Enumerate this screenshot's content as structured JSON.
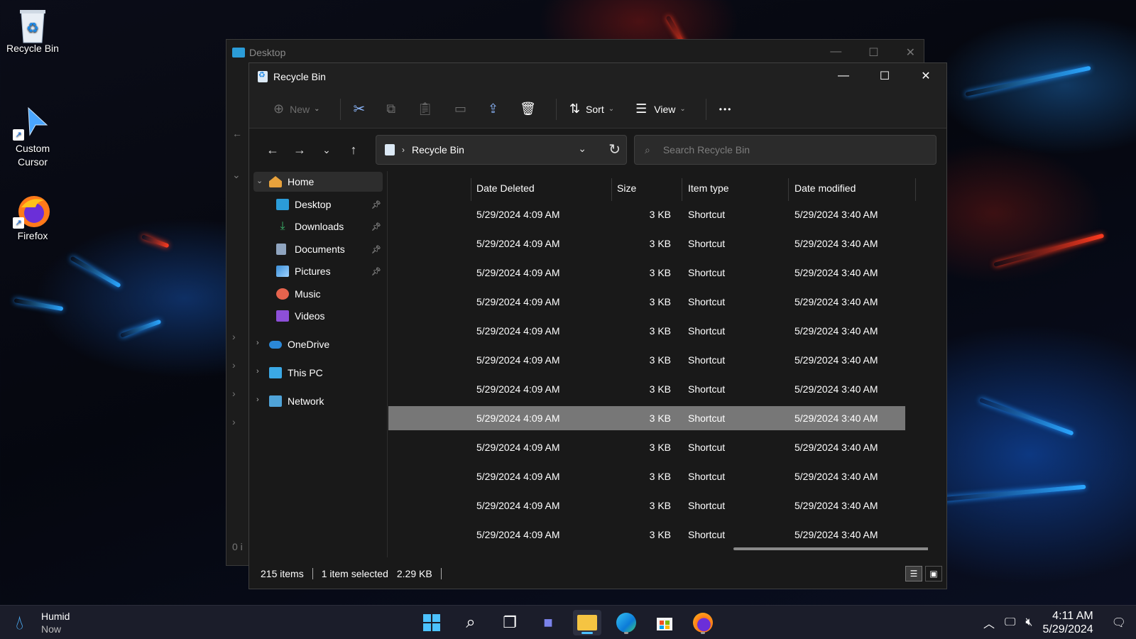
{
  "desktop": {
    "icons": [
      {
        "label": "Recycle Bin",
        "icon": "recycle-bin-icon"
      },
      {
        "label": "Custom Cursor",
        "icon": "cursor-shortcut-icon"
      },
      {
        "label": "Firefox",
        "icon": "firefox-icon"
      }
    ]
  },
  "back_window": {
    "title": "Desktop",
    "status": "0 i"
  },
  "window": {
    "title": "Recycle Bin",
    "controls": {
      "minimize": "—",
      "maximize": "☐",
      "close": "✕"
    }
  },
  "toolbar": {
    "new_label": "New",
    "sort_label": "Sort",
    "view_label": "View",
    "more_label": "•••",
    "icons": [
      "cut-icon",
      "copy-icon",
      "paste-icon",
      "rename-icon",
      "share-icon",
      "delete-icon"
    ]
  },
  "address": {
    "crumb": "Recycle Bin",
    "search_placeholder": "Search Recycle Bin"
  },
  "sidebar": {
    "home": "Home",
    "quick": [
      {
        "label": "Desktop",
        "pinned": true,
        "color": "#2b9cd8"
      },
      {
        "label": "Downloads",
        "pinned": true,
        "color": "#3bb36b"
      },
      {
        "label": "Documents",
        "pinned": true,
        "color": "#8fa4bf"
      },
      {
        "label": "Pictures",
        "pinned": true,
        "color": "#3b8fd8"
      },
      {
        "label": "Music",
        "pinned": false,
        "color": "#e5634d"
      },
      {
        "label": "Videos",
        "pinned": false,
        "color": "#8d4fd8"
      }
    ],
    "sections": [
      {
        "label": "OneDrive",
        "color": "#2b88d8"
      },
      {
        "label": "This PC",
        "color": "#3ba9e6"
      },
      {
        "label": "Network",
        "color": "#4fa3d8"
      }
    ]
  },
  "list": {
    "columns": [
      "Date Deleted",
      "Size",
      "Item type",
      "Date modified"
    ],
    "rows": [
      {
        "deleted": "5/29/2024 4:09 AM",
        "size": "3 KB",
        "type": "Shortcut",
        "modified": "5/29/2024 3:40 AM",
        "selected": false
      },
      {
        "deleted": "5/29/2024 4:09 AM",
        "size": "3 KB",
        "type": "Shortcut",
        "modified": "5/29/2024 3:40 AM",
        "selected": false
      },
      {
        "deleted": "5/29/2024 4:09 AM",
        "size": "3 KB",
        "type": "Shortcut",
        "modified": "5/29/2024 3:40 AM",
        "selected": false
      },
      {
        "deleted": "5/29/2024 4:09 AM",
        "size": "3 KB",
        "type": "Shortcut",
        "modified": "5/29/2024 3:40 AM",
        "selected": false
      },
      {
        "deleted": "5/29/2024 4:09 AM",
        "size": "3 KB",
        "type": "Shortcut",
        "modified": "5/29/2024 3:40 AM",
        "selected": false
      },
      {
        "deleted": "5/29/2024 4:09 AM",
        "size": "3 KB",
        "type": "Shortcut",
        "modified": "5/29/2024 3:40 AM",
        "selected": false
      },
      {
        "deleted": "5/29/2024 4:09 AM",
        "size": "3 KB",
        "type": "Shortcut",
        "modified": "5/29/2024 3:40 AM",
        "selected": false
      },
      {
        "deleted": "5/29/2024 4:09 AM",
        "size": "3 KB",
        "type": "Shortcut",
        "modified": "5/29/2024 3:40 AM",
        "selected": true
      },
      {
        "deleted": "5/29/2024 4:09 AM",
        "size": "3 KB",
        "type": "Shortcut",
        "modified": "5/29/2024 3:40 AM",
        "selected": false
      },
      {
        "deleted": "5/29/2024 4:09 AM",
        "size": "3 KB",
        "type": "Shortcut",
        "modified": "5/29/2024 3:40 AM",
        "selected": false
      },
      {
        "deleted": "5/29/2024 4:09 AM",
        "size": "3 KB",
        "type": "Shortcut",
        "modified": "5/29/2024 3:40 AM",
        "selected": false
      },
      {
        "deleted": "5/29/2024 4:09 AM",
        "size": "3 KB",
        "type": "Shortcut",
        "modified": "5/29/2024 3:40 AM",
        "selected": false
      }
    ]
  },
  "status": {
    "count": "215 items",
    "selected": "1 item selected",
    "size": "2.29 KB"
  },
  "taskbar": {
    "weather_title": "Humid",
    "weather_sub": "Now",
    "apps": [
      "start-icon",
      "search-icon",
      "task-view-icon",
      "chat-icon",
      "file-explorer-icon",
      "edge-icon",
      "store-icon",
      "firefox-icon"
    ],
    "time": "4:11 AM",
    "date": "5/29/2024"
  },
  "colors": {
    "accent": "#4cc2ff",
    "selection": "#777777",
    "window_bg": "#191919"
  }
}
